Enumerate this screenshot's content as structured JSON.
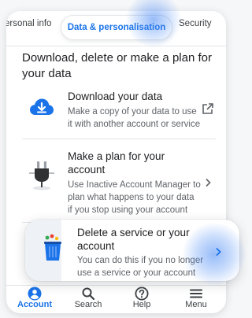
{
  "tabs": {
    "left_label": "ersonal info",
    "active_label": "Data & personalisation",
    "right_label": "Security"
  },
  "section": {
    "title": "Download, delete or make a plan for your data"
  },
  "items": [
    {
      "title": "Download your data",
      "description_lines": [
        "Make a copy of your data to use",
        "it with another account or service"
      ],
      "icon": "cloud-download-icon",
      "action_icon": "open-external-icon"
    },
    {
      "title_lines": [
        "Make a plan for your",
        "account"
      ],
      "description_lines": [
        "Use Inactive Account Manager to",
        "plan what happens to your data",
        "if you stop using your account"
      ],
      "icon": "power-plug-icon",
      "action_icon": "chevron-right-icon"
    },
    {
      "title_lines": [
        "Delete a service or your",
        "account"
      ],
      "description_lines": [
        "You can do this if you no longer",
        "use a service or your account"
      ],
      "icon": "trash-bin-icon",
      "action_icon": "chevron-right-icon"
    }
  ],
  "bottom_nav": [
    {
      "label": "Account",
      "icon": "account-circle-icon",
      "active": true
    },
    {
      "label": "Search",
      "icon": "search-icon",
      "active": false
    },
    {
      "label": "Help",
      "icon": "help-icon",
      "active": false
    },
    {
      "label": "Menu",
      "icon": "menu-icon",
      "active": false
    }
  ],
  "colors": {
    "accent": "#1a73e8",
    "text_primary": "#202124",
    "text_secondary": "#5f6368",
    "glow": "#4285f4"
  }
}
